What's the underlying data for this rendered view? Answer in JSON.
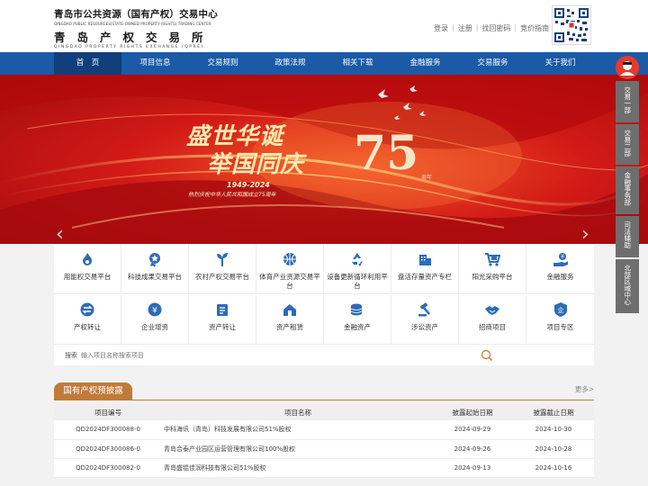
{
  "header": {
    "logo_line1": "青岛市公共资源（国有产权）交易中心",
    "logo_line2": "QINGDAO PUBLIC RESOURCES(STATE-OWNED PROPERTY RIGHTS) TRADING CENTER",
    "logo_line3": "青岛产权交易所",
    "logo_line4": "QINGDAO PROPERTY RIGHTS EXCHANGE (QPRE)",
    "links": [
      "登录",
      "注册",
      "找回密码",
      "竞价指南"
    ]
  },
  "nav": [
    "首　页",
    "项目信息",
    "交易规则",
    "政策法规",
    "相关下载",
    "金融服务",
    "交易服务",
    "关于我们"
  ],
  "banner": {
    "title1": "盛世华诞",
    "title2": "举国同庆",
    "number": "75",
    "suffix": "周年",
    "years": "1949-2024",
    "subtitle": "热烈庆祝中华人民共和国成立75周年"
  },
  "sidebar": [
    "交易一部",
    "交易二部",
    "金融事务部",
    "司法辅助",
    "北部区域中心"
  ],
  "services_row1": [
    {
      "label": "用能权交易平台",
      "icon": "flame-icon"
    },
    {
      "label": "科技成果交易平台",
      "icon": "award-icon"
    },
    {
      "label": "农村产权交易平台",
      "icon": "sprout-icon"
    },
    {
      "label": "体育产业资源交易平台",
      "icon": "ball-icon"
    },
    {
      "label": "设备更新循环利用平台",
      "icon": "recycle-icon"
    },
    {
      "label": "盘活存量资产专栏",
      "icon": "building-icon"
    },
    {
      "label": "阳光采购平台",
      "icon": "cart-icon"
    },
    {
      "label": "金融服务",
      "icon": "finance-hand-icon"
    }
  ],
  "services_row2": [
    {
      "label": "产权转让",
      "icon": "transfer-icon"
    },
    {
      "label": "企业增资",
      "icon": "capital-icon"
    },
    {
      "label": "资产转让",
      "icon": "asset-icon"
    },
    {
      "label": "资产租赁",
      "icon": "house-icon"
    },
    {
      "label": "金融资产",
      "icon": "coins-icon"
    },
    {
      "label": "涉讼资产",
      "icon": "gavel-icon"
    },
    {
      "label": "招商项目",
      "icon": "handshake-icon"
    },
    {
      "label": "项目专区",
      "icon": "zone-icon"
    }
  ],
  "search": {
    "label": "搜索",
    "placeholder": "输入项目名称搜索项目"
  },
  "section": {
    "title": "国有产权预披露",
    "more": "更多>",
    "columns": [
      "项目编号",
      "项目名称",
      "披露起始日期",
      "披露截止日期"
    ],
    "rows": [
      [
        "QD2024DF300088-0",
        "中科海讯（青岛）科技发展有限公司51%股权",
        "2024-09-29",
        "2024-10-30"
      ],
      [
        "QD2024DF300086-0",
        "青岛合泰产业园区运营管理有限公司100%股权",
        "2024-09-26",
        "2024-10-28"
      ],
      [
        "QD2024DF300082-0",
        "青岛盛锟佳润科技有限公司51%股权",
        "2024-09-13",
        "2024-10-16"
      ]
    ]
  },
  "colors": {
    "nav": "#1a5aa6",
    "accent": "#c07a3a",
    "banner_red": "#c8141b",
    "icon_blue": "#2d6cb5"
  }
}
